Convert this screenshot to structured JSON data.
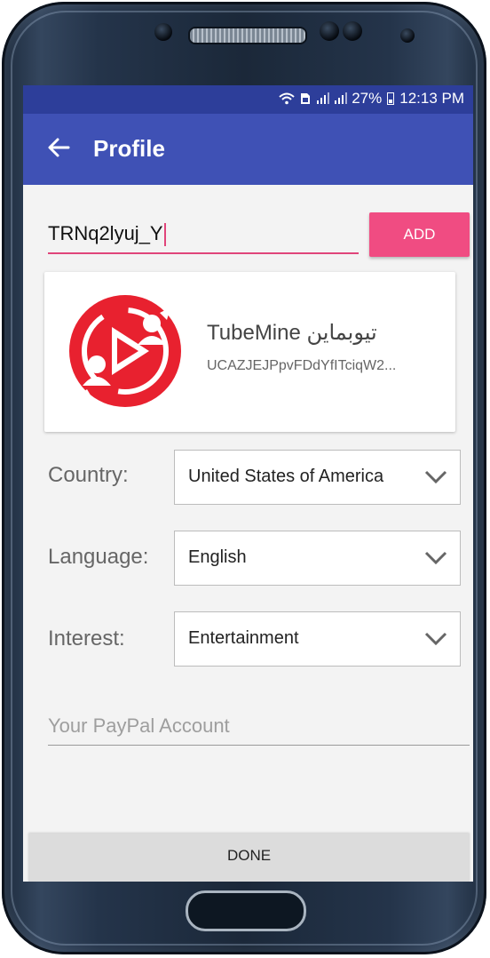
{
  "status_bar": {
    "battery": "27%",
    "time": "12:13 PM"
  },
  "app_bar": {
    "title": "Profile"
  },
  "channel_input": {
    "value": "TRNq2lyuj_Y"
  },
  "add_button": {
    "label": "ADD"
  },
  "channel_card": {
    "name": "TubeMine تیوبماین",
    "id": "UCAZJEJPpvFDdYfITciqW2..."
  },
  "country": {
    "label": "Country:",
    "value": "United States of America"
  },
  "language": {
    "label": "Language:",
    "value": "English"
  },
  "interest": {
    "label": "Interest:",
    "value": "Entertainment"
  },
  "paypal": {
    "placeholder": "Your PayPal Account"
  },
  "done_button": {
    "label": "DONE"
  },
  "colors": {
    "status_bar": "#2d3e9a",
    "app_bar": "#3f51b5",
    "accent": "#f04c82",
    "logo_red": "#e8212f"
  }
}
